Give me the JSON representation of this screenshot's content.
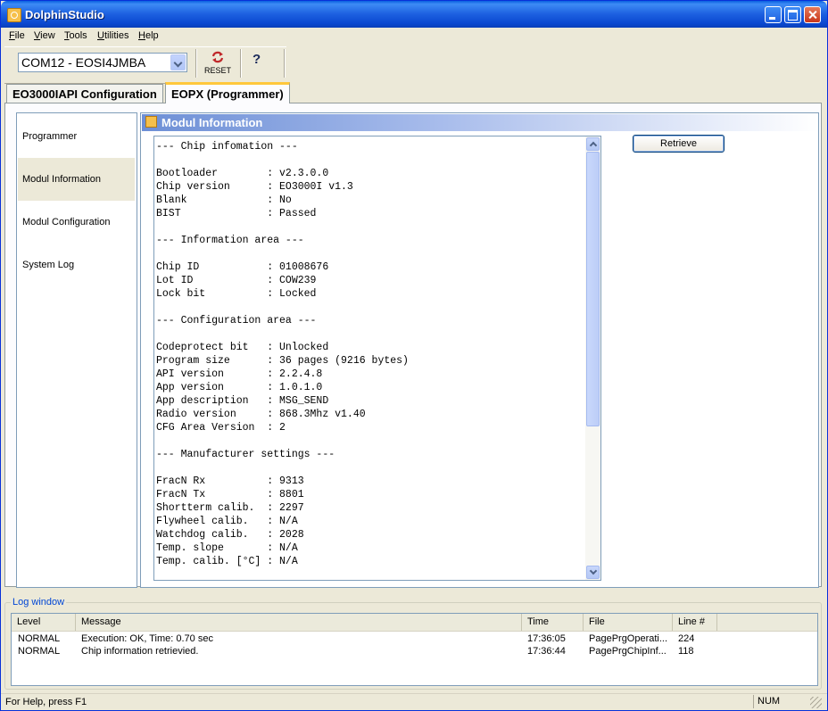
{
  "window": {
    "title": "DolphinStudio"
  },
  "menu": [
    {
      "pre": "",
      "key": "F",
      "post": "ile"
    },
    {
      "pre": "",
      "key": "V",
      "post": "iew"
    },
    {
      "pre": "",
      "key": "T",
      "post": "ools"
    },
    {
      "pre": "",
      "key": "U",
      "post": "tilities"
    },
    {
      "pre": "",
      "key": "H",
      "post": "elp"
    }
  ],
  "toolbar": {
    "port": "COM12 - EOSI4JMBA",
    "reset_label": "RESET",
    "help_glyph": "?"
  },
  "tabs": [
    "EO3000IAPI Configuration",
    "EOPX (Programmer)"
  ],
  "nav": [
    "Programmer",
    "Modul Information",
    "Modul Configuration",
    "System Log"
  ],
  "panel": {
    "title": "Modul Information",
    "retrieve_label": "Retrieve",
    "lines": [
      "--- Chip infomation ---",
      "",
      "Bootloader        : v2.3.0.0",
      "Chip version      : EO3000I v1.3",
      "Blank             : No",
      "BIST              : Passed",
      "",
      "--- Information area ---",
      "",
      "Chip ID           : 01008676",
      "Lot ID            : COW239",
      "Lock bit          : Locked",
      "",
      "--- Configuration area ---",
      "",
      "Codeprotect bit   : Unlocked",
      "Program size      : 36 pages (9216 bytes)",
      "API version       : 2.2.4.8",
      "App version       : 1.0.1.0",
      "App description   : MSG_SEND",
      "Radio version     : 868.3Mhz v1.40",
      "CFG Area Version  : 2",
      "",
      "--- Manufacturer settings ---",
      "",
      "FracN Rx          : 9313",
      "FracN Tx          : 8801",
      "Shortterm calib.  : 2297",
      "Flywheel calib.   : N/A",
      "Watchdog calib.   : 2028",
      "Temp. slope       : N/A",
      "Temp. calib. [°C] : N/A"
    ]
  },
  "log": {
    "title": "Log window",
    "columns": [
      "Level",
      "Message",
      "Time",
      "File",
      "Line #"
    ],
    "rows": [
      [
        "NORMAL",
        "Execution: OK, Time: 0.70 sec",
        "17:36:05",
        "PagePrgOperati...",
        "224"
      ],
      [
        "NORMAL",
        "Chip information retrievied.",
        "17:36:44",
        "PagePrgChipInf...",
        "118"
      ]
    ]
  },
  "status": {
    "help": "For Help, press F1",
    "num": "NUM"
  }
}
